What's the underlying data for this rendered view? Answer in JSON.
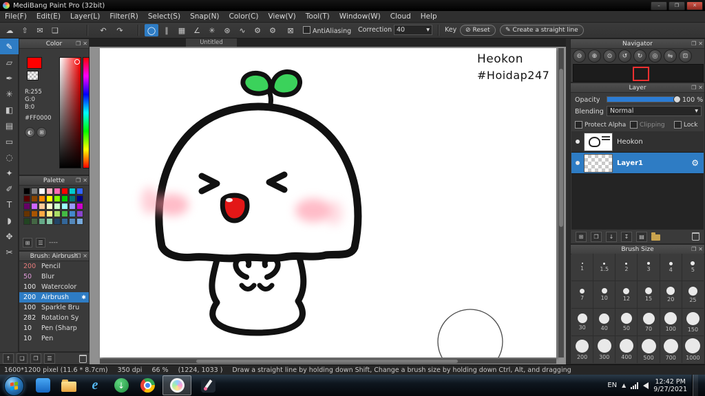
{
  "window": {
    "title": "MediBang Paint Pro (32bit)"
  },
  "menu": {
    "items": [
      "File(F)",
      "Edit(E)",
      "Layer(L)",
      "Filter(R)",
      "Select(S)",
      "Snap(N)",
      "Color(C)",
      "View(V)",
      "Tool(T)",
      "Window(W)",
      "Cloud",
      "Help"
    ]
  },
  "toolbar": {
    "antialiasing": "AntiAliasing",
    "correction_label": "Correction",
    "correction_value": "40",
    "key_label": "Key",
    "reset_label": "Reset",
    "create_line_label": "Create a straight line"
  },
  "tab": {
    "title": "Untitled"
  },
  "color_panel": {
    "title": "Color",
    "r": "R:255",
    "g": "G:0",
    "b": "B:0",
    "hex": "#FF0000",
    "current": "#ff0000"
  },
  "palette_panel": {
    "title": "Palette",
    "name_label": "----",
    "colors": [
      "#000000",
      "#7f7f7f",
      "#ffffff",
      "#ffb6c1",
      "#ff69b4",
      "#ff0000",
      "#00cccc",
      "#3366ff",
      "#550000",
      "#884400",
      "#ff8800",
      "#ffff00",
      "#88ff00",
      "#00cc00",
      "#007777",
      "#000088",
      "#660066",
      "#cc66ff",
      "#ffcc99",
      "#ffffcc",
      "#ccffcc",
      "#99ffff",
      "#9999ff",
      "#cc00cc",
      "#663300",
      "#aa5500",
      "#ffaa44",
      "#ffee88",
      "#aadd66",
      "#44bb44",
      "#4488cc",
      "#8844cc",
      "#224422",
      "#446644",
      "#66aa88",
      "#88ccaa",
      "#224466",
      "#336699",
      "#5588bb",
      "#77aadd"
    ]
  },
  "brush_panel": {
    "title": "Brush: Airbrush",
    "brushes": [
      {
        "size": "200",
        "name": "Pencil",
        "color": "#e87c7c"
      },
      {
        "size": "50",
        "name": "Blur",
        "color": "#e09ad8"
      },
      {
        "size": "100",
        "name": "Watercolor",
        "color": "#e8e8e8"
      },
      {
        "size": "200",
        "name": "Airbrush",
        "color": "#ffffff"
      },
      {
        "size": "100",
        "name": "Sparkle Bru",
        "color": "#e8e8e8"
      },
      {
        "size": "282",
        "name": "Rotation Sy",
        "color": "#e8e8e8"
      },
      {
        "size": "10",
        "name": "Pen (Sharp",
        "color": "#e8e8e8"
      },
      {
        "size": "10",
        "name": "Pen",
        "color": "#e8e8e8"
      }
    ]
  },
  "navigator": {
    "title": "Navigator"
  },
  "layer_panel": {
    "title": "Layer",
    "opacity_label": "Opacity",
    "opacity_value": "100 %",
    "blending_label": "Blending",
    "blending_value": "Normal",
    "protect_alpha": "Protect Alpha",
    "clipping": "Clipping",
    "lock": "Lock",
    "layers": [
      {
        "name": "Heokon"
      },
      {
        "name": "Layer1"
      }
    ]
  },
  "brush_size_panel": {
    "title": "Brush Size",
    "sizes": [
      "1",
      "1.5",
      "2",
      "3",
      "4",
      "5",
      "7",
      "10",
      "12",
      "15",
      "20",
      "25",
      "30",
      "40",
      "50",
      "70",
      "100",
      "150",
      "200",
      "300",
      "400",
      "500",
      "700",
      "1000"
    ]
  },
  "canvas": {
    "signature_line1": "Heokon",
    "signature_line2": "#Hoidap247"
  },
  "status_bar": {
    "dimensions": "1600*1200 pixel (11.6 * 8.7cm)",
    "dpi": "350 dpi",
    "zoom": "66 %",
    "coordinates": "(1224, 1033 )",
    "hint": "Draw a straight line by holding down Shift, Change a brush size by holding down Ctrl, Alt, and dragging"
  },
  "taskbar": {
    "language": "EN",
    "time": "12:42 PM",
    "date": "9/27/2021"
  },
  "accent": {
    "selection": "#2e7cc4",
    "slider": "#2b7cd4"
  },
  "glyphs": {
    "minimize": "–",
    "maximize": "❐",
    "close": "✕",
    "popout": "❐",
    "undo": "↶",
    "redo": "↷",
    "cloud": "☁",
    "upload": "⇧",
    "mail": "✉",
    "page": "❑",
    "caret": "▾",
    "menu": "☰",
    "add": "⊞",
    "star": "✱",
    "gear": "⚙",
    "slash": "⊘",
    "pencil": "✎",
    "tools": [
      "✎",
      "▱",
      "✒",
      "✳",
      "◧",
      "▤",
      "▭",
      "◌",
      "✦",
      "✐",
      "T",
      "◗",
      "✥",
      "✂"
    ],
    "snaps": [
      "◯",
      "∥",
      "▦",
      "∠",
      "✳",
      "⊛",
      "∿",
      "⚙",
      "⚙",
      "⊠"
    ],
    "nav": [
      "⊖",
      "⊕",
      "⊙",
      "↺",
      "↻",
      "◎",
      "⇋",
      "⊡"
    ],
    "layer_ops": [
      "⊞",
      "❐",
      "↓",
      "↧",
      "▤"
    ],
    "brush_ops": [
      "↑",
      "❏",
      "❐",
      "☰"
    ]
  }
}
